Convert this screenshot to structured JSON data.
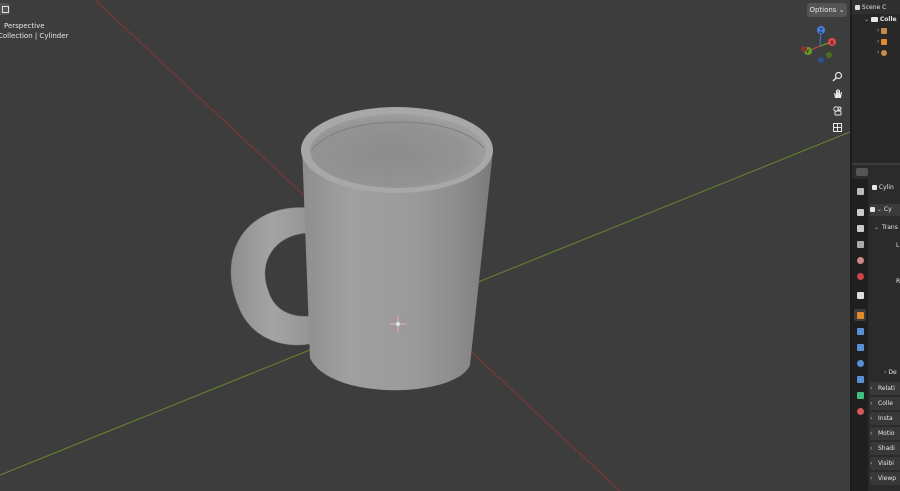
{
  "viewport": {
    "view_label": "User Perspective",
    "view_label_visible": "Perspective",
    "collection_label": "Collection | Cylinder",
    "options_label": "Options",
    "options_chevron": "⌄",
    "gizmo": {
      "x": "X",
      "y": "Y",
      "z": "Z"
    },
    "nav_tools": [
      "zoom-icon",
      "hand-icon",
      "camera-icon",
      "grid-icon"
    ]
  },
  "outliner": {
    "header": "Scene C",
    "rows": [
      {
        "label": "Colle",
        "icon": "collection-icon"
      },
      {
        "label": "",
        "icon": "camera-object-icon"
      },
      {
        "label": "",
        "icon": "cylinder-object-icon"
      },
      {
        "label": "",
        "icon": "light-object-icon"
      }
    ]
  },
  "properties": {
    "object_name": "Cylin",
    "data_name": "Cy",
    "sections": {
      "transform": "Trans",
      "delta": "De",
      "relations": "Relati",
      "collections": "Colle",
      "instancing": "Insta",
      "motion": "Motio",
      "shading": "Shadi",
      "visibility": "Visibi",
      "viewport_display": "Viewp"
    },
    "transform_letters": [
      "L",
      "R"
    ]
  },
  "colors": {
    "background": "#3d3d3d",
    "x_axis": "#8a3434",
    "y_axis": "#6b8a2c",
    "mug": "#9a9a9a",
    "active_tab": "#e38b2a"
  }
}
